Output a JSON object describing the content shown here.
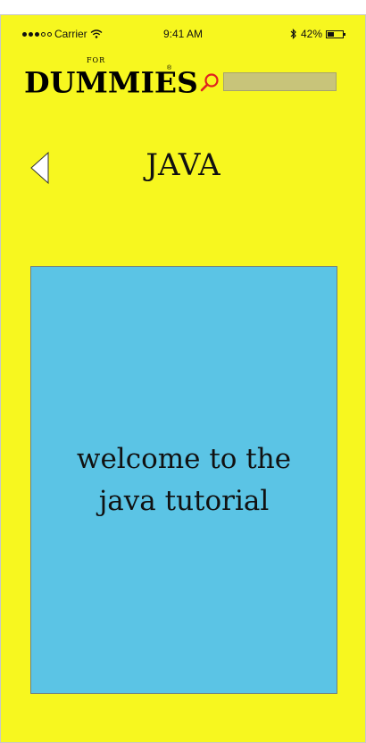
{
  "status_bar": {
    "carrier": "Carrier",
    "time": "9:41 AM",
    "battery_percent": "42%",
    "battery_level": 0.42,
    "icons": [
      "signal-dots-icon",
      "wifi-icon",
      "bluetooth-icon",
      "battery-icon"
    ]
  },
  "header": {
    "logo_small": "FOR",
    "logo_main": "DUMMIES",
    "logo_mark": "®",
    "search_icon": "search-icon",
    "search_value": ""
  },
  "nav": {
    "back_icon": "back-arrow-icon",
    "title": "JAVA"
  },
  "content": {
    "message": "welcome to the java tutorial"
  },
  "colors": {
    "background": "#f7f71f",
    "card": "#5bc4e5",
    "search_field": "#c8c47a",
    "search_icon": "#e02020"
  }
}
